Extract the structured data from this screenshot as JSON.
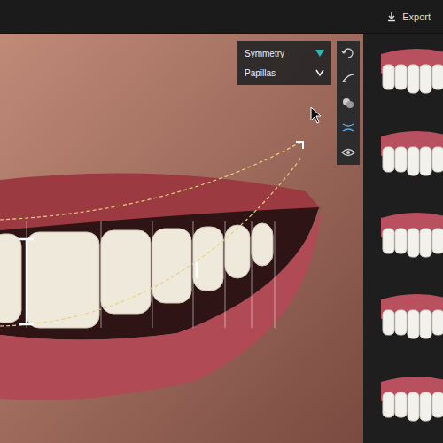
{
  "topbar": {
    "export": {
      "label": "Export"
    }
  },
  "options_panel": [
    {
      "label": "Symmetry",
      "selected": true
    },
    {
      "label": "Papillas",
      "selected": false
    }
  ],
  "tools": [
    {
      "kind": "rotate"
    },
    {
      "kind": "pen"
    },
    {
      "kind": "circles"
    },
    {
      "kind": "guide"
    },
    {
      "kind": "eye"
    }
  ],
  "variants": [
    {
      "selected": false
    },
    {
      "selected": false
    },
    {
      "selected": false
    },
    {
      "selected": false
    },
    {
      "selected": false
    }
  ]
}
